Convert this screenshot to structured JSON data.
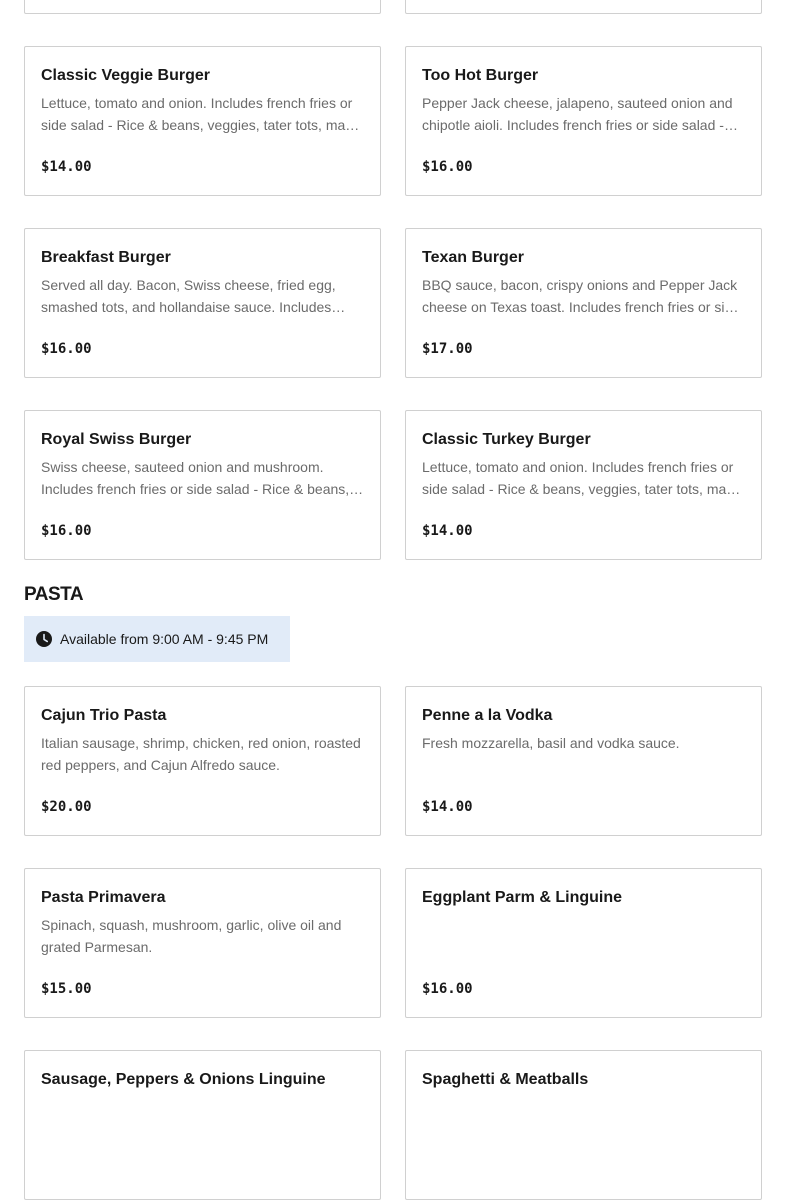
{
  "top_cards": [
    {},
    {}
  ],
  "burgers": [
    {
      "name": "Classic Veggie Burger",
      "description": "Lettuce, tomato and onion. Includes french fries or side salad - Rice & beans, veggies, tater tots, mac & cheese, or onion rings available for an upcharge.",
      "price": "$14.00"
    },
    {
      "name": "Too Hot Burger",
      "description": "Pepper Jack cheese, jalapeno, sauteed onion and chipotle aioli. Includes french fries or side salad - Rice & beans, veggies, tater tots, mac & cheese, or onion rings available for an upcharge.",
      "price": "$16.00"
    },
    {
      "name": "Breakfast Burger",
      "description": "Served all day. Bacon, Swiss cheese, fried egg, smashed tots, and hollandaise sauce. Includes french fries or side salad.",
      "price": "$16.00"
    },
    {
      "name": "Texan Burger",
      "description": "BBQ sauce, bacon, crispy onions and Pepper Jack cheese on Texas toast. Includes french fries or side salad.",
      "price": "$17.00"
    },
    {
      "name": "Royal Swiss Burger",
      "description": "Swiss cheese, sauteed onion and mushroom. Includes french fries or side salad - Rice & beans, veggies, tater tots, mac & cheese, or onion rings available for an upcharge.",
      "price": "$16.00"
    },
    {
      "name": "Classic Turkey Burger",
      "description": "Lettuce, tomato and onion. Includes french fries or side salad - Rice & beans, veggies, tater tots, mac & cheese, or onion rings available for an upcharge.",
      "price": "$14.00"
    }
  ],
  "pasta_section": {
    "title": "PASTA",
    "availability": "Available from 9:00 AM - 9:45 PM",
    "icon": "clock-icon"
  },
  "pasta": [
    {
      "name": "Cajun Trio Pasta",
      "description": "Italian sausage, shrimp, chicken, red onion, roasted red peppers, and Cajun Alfredo sauce.",
      "price": "$20.00"
    },
    {
      "name": "Penne a la Vodka",
      "description": "Fresh mozzarella, basil and vodka sauce.",
      "price": "$14.00"
    },
    {
      "name": "Pasta Primavera",
      "description": "Spinach, squash, mushroom, garlic, olive oil and grated Parmesan.",
      "price": "$15.00"
    },
    {
      "name": "Eggplant Parm & Linguine",
      "description": "",
      "price": "$16.00"
    },
    {
      "name": "Sausage, Peppers & Onions Linguine",
      "description": "",
      "price": ""
    },
    {
      "name": "Spaghetti & Meatballs",
      "description": "",
      "price": ""
    }
  ],
  "colors": {
    "card_border": "#d0d0d0",
    "text": "#191919",
    "muted_text": "#6b6b6b",
    "availability_bg": "#e1ebf8"
  }
}
